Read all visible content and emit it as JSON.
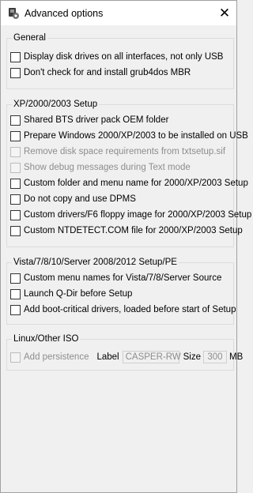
{
  "window": {
    "title": "Advanced options",
    "close_glyph": "✕"
  },
  "groups": [
    {
      "title": "General",
      "items": [
        {
          "label": "Display disk drives on all interfaces, not only USB",
          "enabled": true,
          "checked": false
        },
        {
          "label": "Don't check for and install grub4dos MBR",
          "enabled": true,
          "checked": false
        }
      ]
    },
    {
      "title": "XP/2000/2003 Setup",
      "items": [
        {
          "label": "Shared BTS driver pack OEM folder",
          "enabled": true,
          "checked": false
        },
        {
          "label": "Prepare Windows 2000/XP/2003 to be installed on USB",
          "enabled": true,
          "checked": false
        },
        {
          "label": "Remove disk space requirements from txtsetup.sif",
          "enabled": false,
          "checked": false
        },
        {
          "label": "Show debug messages during Text mode",
          "enabled": false,
          "checked": false
        },
        {
          "label": "Custom folder and menu name for 2000/XP/2003 Setup",
          "enabled": true,
          "checked": false
        },
        {
          "label": "Do not copy and use DPMS",
          "enabled": true,
          "checked": false
        },
        {
          "label": "Custom drivers/F6 floppy image for 2000/XP/2003 Setup",
          "enabled": true,
          "checked": false
        },
        {
          "label": "Custom NTDETECT.COM file for 2000/XP/2003 Setup",
          "enabled": true,
          "checked": false
        }
      ]
    },
    {
      "title": "Vista/7/8/10/Server 2008/2012 Setup/PE",
      "items": [
        {
          "label": "Custom menu names for Vista/7/8/Server Source",
          "enabled": true,
          "checked": false
        },
        {
          "label": "Launch Q-Dir before Setup",
          "enabled": true,
          "checked": false
        },
        {
          "label": "Add boot-critical drivers, loaded before start of Setup",
          "enabled": true,
          "checked": false
        }
      ]
    },
    {
      "title": "Linux/Other ISO",
      "persistence": {
        "label": "Add persistence",
        "enabled": false,
        "checked": false,
        "name_label": "Label",
        "name_value": "CASPER-RW",
        "size_label": "Size",
        "size_value": "300",
        "size_unit": "MB"
      }
    }
  ],
  "colors": {
    "title_bar": "#ffffff",
    "window_bg": "#f0f0f0",
    "disabled_text": "#8d8d8d",
    "group_border": "#dcdcdc"
  },
  "icons": {
    "app": "usb-gear-icon",
    "close": "close-icon"
  }
}
